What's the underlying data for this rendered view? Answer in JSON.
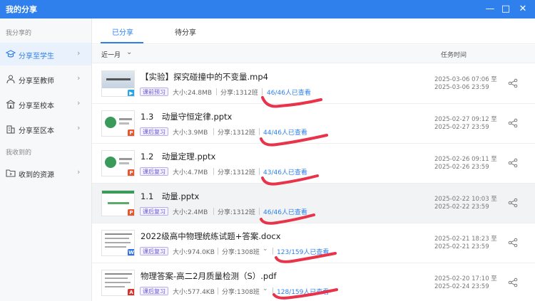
{
  "window": {
    "title": "我的分享"
  },
  "sidebar": {
    "groups": [
      {
        "label": "我分享的"
      },
      {
        "label": "我收到的"
      }
    ],
    "items": [
      {
        "label": "分享至学生",
        "icon": "cap-icon"
      },
      {
        "label": "分享至教师",
        "icon": "teacher-icon"
      },
      {
        "label": "分享至校本",
        "icon": "school-icon"
      },
      {
        "label": "分享至区本",
        "icon": "district-icon"
      },
      {
        "label": "收到的资源",
        "icon": "folder-icon"
      }
    ]
  },
  "tabs": [
    {
      "label": "已分享"
    },
    {
      "label": "待分享"
    }
  ],
  "filter": {
    "label": "近一月"
  },
  "column": {
    "time_header": "任务时间"
  },
  "rows": [
    {
      "name": "【实验】探究碰撞中的不变量.mp4",
      "tag": "课前预习",
      "size": "大小:24.8MB",
      "share": "分享:1312班",
      "viewed": "46/46人已查看",
      "time1": "2025-03-06 07:06 至",
      "time2": "2025-03-06 23:59",
      "file_type": "video"
    },
    {
      "name": "1.3　动量守恒定律.pptx",
      "tag": "课后复习",
      "size": "大小:3.9MB",
      "share": "分享:1312班",
      "viewed": "44/46人已查看",
      "time1": "2025-02-27 09:12 至",
      "time2": "2025-02-27 23:59",
      "file_type": "ppt"
    },
    {
      "name": "1.2　动量定理.pptx",
      "tag": "课后复习",
      "size": "大小:4.7MB",
      "share": "分享:1312班",
      "viewed": "43/46人已查看",
      "time1": "2025-02-26 09:11 至",
      "time2": "2025-02-26 23:59",
      "file_type": "ppt"
    },
    {
      "name": "1.1　动量.pptx",
      "tag": "课后复习",
      "size": "大小:2.4MB",
      "share": "分享:1312班",
      "viewed": "46/46人已查看",
      "time1": "2025-02-22 10:03 至",
      "time2": "2025-02-22 23:59",
      "file_type": "ppt"
    },
    {
      "name": "2022级高中物理统练试题+答案.docx",
      "tag": "课后复习",
      "size": "大小:974.0KB",
      "share": "分享:1308班",
      "viewed": "123/159人已查看",
      "time1": "2025-02-21 18:23 至",
      "time2": "2025-02-21 23:59",
      "file_type": "word"
    },
    {
      "name": "物理答案-高二2月质量检测（S）.pdf",
      "tag": "课后复习",
      "size": "大小:577.4KB",
      "share": "分享:1308班",
      "viewed": "128/159人已查看",
      "time1": "2025-02-20 17:10 至",
      "time2": "2025-02-24 23:59",
      "file_type": "pdf"
    }
  ],
  "colors": {
    "accent": "#2f80ed",
    "annotation": "#e8334a",
    "ppt": "#e8552f",
    "word": "#2f6fe8",
    "pdf": "#d9322b",
    "video": "#29a7e1"
  }
}
